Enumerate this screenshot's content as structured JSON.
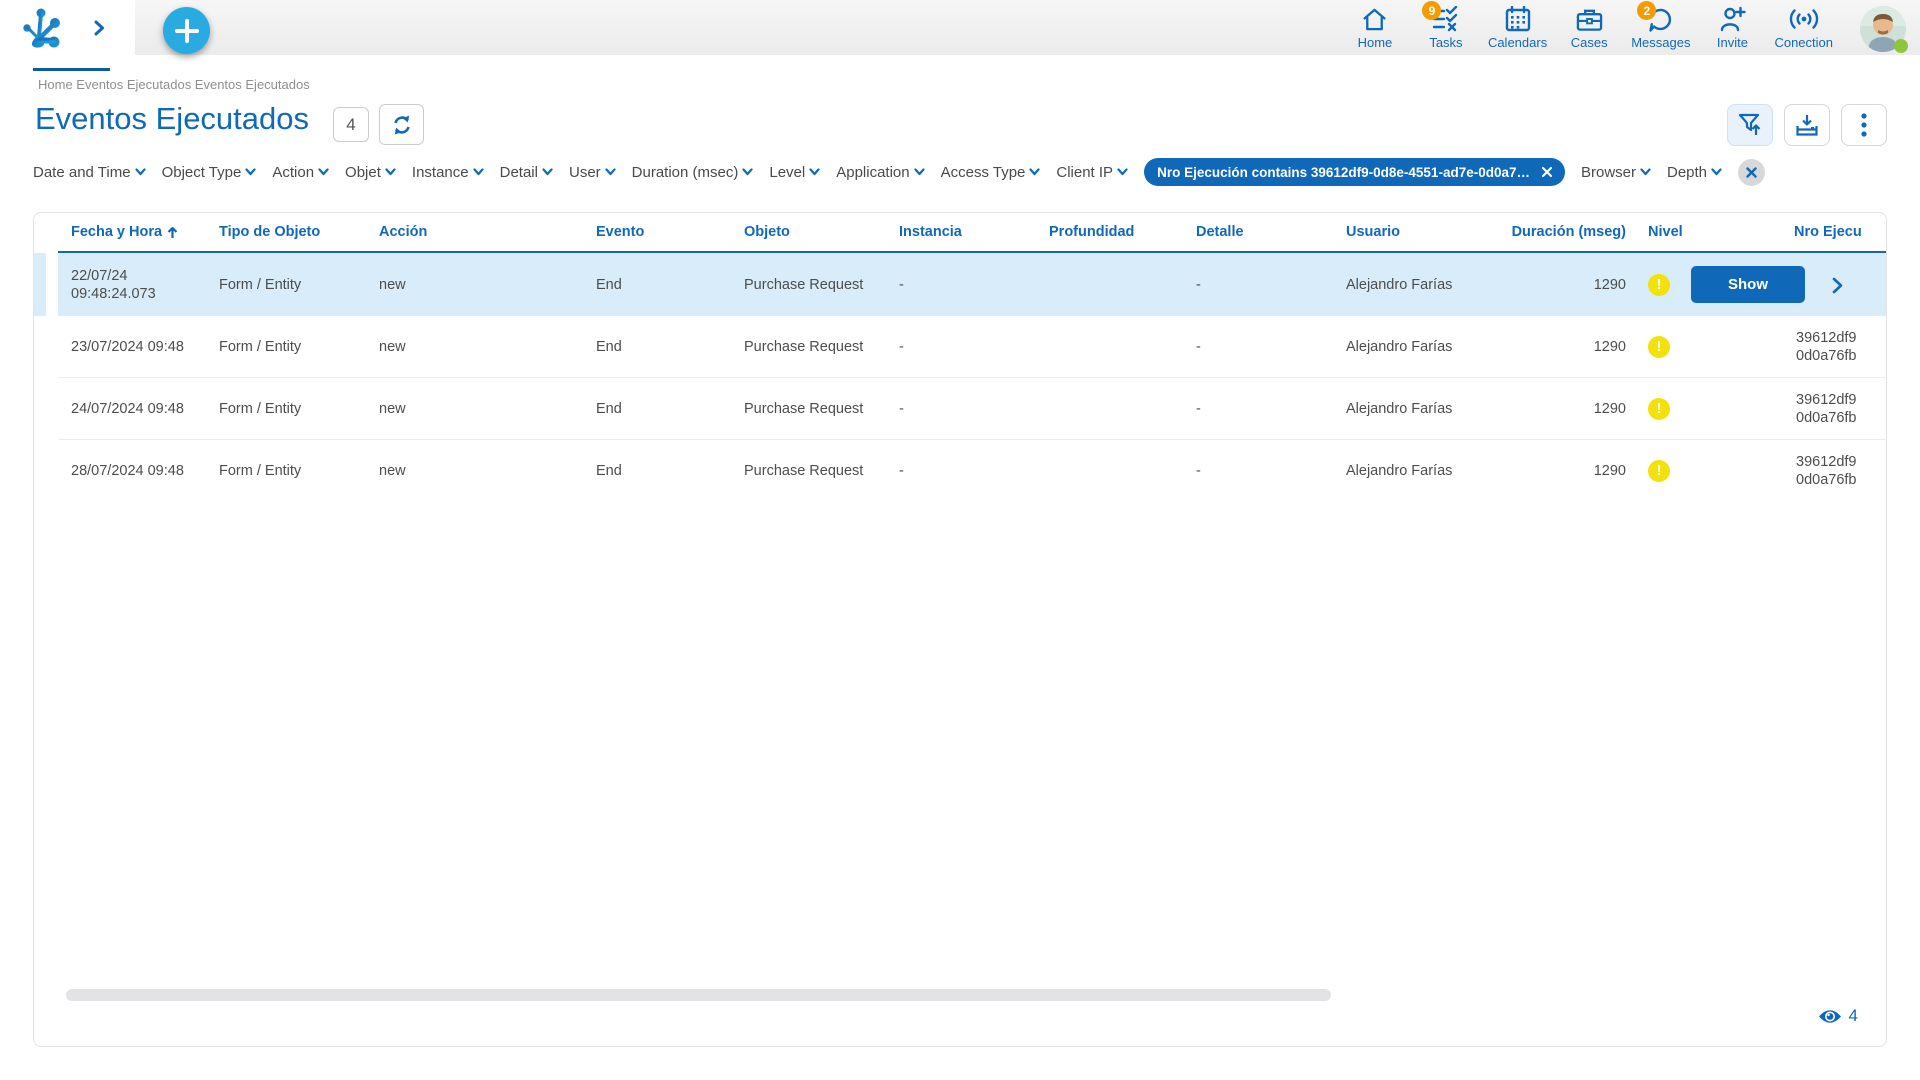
{
  "colors": {
    "accent_blue": "#1069b8",
    "fab_cyan": "#29abe2",
    "badge_orange": "#f59b00",
    "warning_yellow": "#f2e10a",
    "selected_row": "#d9ecf9",
    "status_green": "#8dc63f"
  },
  "header": {
    "nav": [
      {
        "label": "Home",
        "icon": "home-icon",
        "badge": ""
      },
      {
        "label": "Tasks",
        "icon": "tasks-icon",
        "badge": "9"
      },
      {
        "label": "Calendars",
        "icon": "calendar-icon",
        "badge": ""
      },
      {
        "label": "Cases",
        "icon": "briefcase-icon",
        "badge": ""
      },
      {
        "label": "Messages",
        "icon": "chat-bubble-icon",
        "badge": "2"
      },
      {
        "label": "Invite",
        "icon": "invite-person-icon",
        "badge": ""
      },
      {
        "label": "Conection",
        "icon": "connection-signal-icon",
        "badge": ""
      }
    ]
  },
  "breadcrumb": {
    "text": "Home Eventos Ejecutados Eventos Ejecutados"
  },
  "page": {
    "title": "Eventos Ejecutados",
    "count_badge": "4"
  },
  "filters": {
    "labels": [
      "Date and Time",
      "Object Type",
      "Action",
      "Objet",
      "Instance",
      "Detail",
      "User",
      "Duration (msec)",
      "Level",
      "Application",
      "Access Type",
      "Client IP"
    ],
    "chip": {
      "text": "Nro Ejecución contains 39612df9-0d8e-4551-ad7e-0d0a7…"
    },
    "after": [
      "Browser",
      "Depth"
    ]
  },
  "table": {
    "columns": [
      "Fecha y Hora",
      "Tipo de Objeto",
      "Acción",
      "Evento",
      "Objeto",
      "Instancia",
      "Profundidad",
      "Detalle",
      "Usuario",
      "Duración (mseg)",
      "Nivel",
      "Nro Ejecu"
    ],
    "sort_column": "Fecha y Hora",
    "sort_direction": "asc",
    "rows": [
      {
        "fecha": "22/07/24 09:48:24.073",
        "tipo": "Form / Entity",
        "accion": "new",
        "evento": "End",
        "objeto": "Purchase Request",
        "instancia": "-",
        "profundidad": "",
        "detalle": "-",
        "usuario": "Alejandro Farías",
        "duracion": "1290",
        "nivel": "warning",
        "nro_line1": "",
        "nro_line2": "",
        "selected": true,
        "action_label": "Show"
      },
      {
        "fecha": "23/07/2024 09:48",
        "tipo": "Form / Entity",
        "accion": "new",
        "evento": "End",
        "objeto": "Purchase Request",
        "instancia": "-",
        "profundidad": "",
        "detalle": "-",
        "usuario": "Alejandro Farías",
        "duracion": "1290",
        "nivel": "warning",
        "nro_line1": "39612df9",
        "nro_line2": "0d0a76fb",
        "selected": false
      },
      {
        "fecha": "24/07/2024 09:48",
        "tipo": "Form / Entity",
        "accion": "new",
        "evento": "End",
        "objeto": "Purchase Request",
        "instancia": "-",
        "profundidad": "",
        "detalle": "-",
        "usuario": "Alejandro Farías",
        "duracion": "1290",
        "nivel": "warning",
        "nro_line1": "39612df9",
        "nro_line2": "0d0a76fb",
        "selected": false
      },
      {
        "fecha": "28/07/2024 09:48",
        "tipo": "Form / Entity",
        "accion": "new",
        "evento": "End",
        "objeto": "Purchase Request",
        "instancia": "-",
        "profundidad": "",
        "detalle": "-",
        "usuario": "Alejandro Farías",
        "duracion": "1290",
        "nivel": "warning",
        "nro_line1": "39612df9",
        "nro_line2": "0d0a76fb",
        "selected": false
      }
    ]
  },
  "footer": {
    "visible_count": "4"
  }
}
